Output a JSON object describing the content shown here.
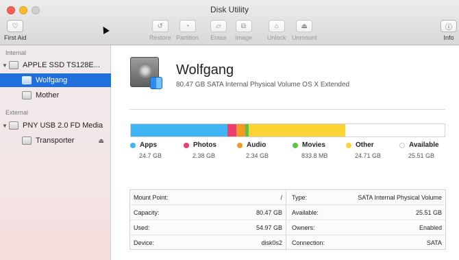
{
  "window": {
    "title": "Disk Utility"
  },
  "toolbar": {
    "first_aid": {
      "label": "First Aid",
      "icon": "stethoscope-icon"
    },
    "restore": {
      "label": "Restore",
      "icon": "restore-icon"
    },
    "partition": {
      "label": "Partition",
      "icon": "partition-icon"
    },
    "erase": {
      "label": "Erase",
      "icon": "erase-icon"
    },
    "image": {
      "label": "Image",
      "icon": "image-icon"
    },
    "unlock": {
      "label": "Unlock",
      "icon": "lock-icon"
    },
    "unmount": {
      "label": "Unmount",
      "icon": "unmount-icon"
    },
    "info": {
      "label": "Info",
      "icon": "info-icon"
    }
  },
  "sidebar": {
    "internal_header": "Internal",
    "external_header": "External",
    "internal_disk": "APPLE SSD TS128E...",
    "volumes_internal": [
      "Wolfgang",
      "Mother"
    ],
    "external_disk": "PNY USB 2.0 FD Media",
    "volumes_external": [
      "Transporter"
    ],
    "selected": "Wolfgang"
  },
  "volume": {
    "name": "Wolfgang",
    "description": "80.47 GB SATA Internal Physical Volume OS X Extended"
  },
  "usage": {
    "segments": [
      {
        "name": "Apps",
        "size": "24.7 GB",
        "gb": 24.7,
        "color": "#3fb5f3"
      },
      {
        "name": "Photos",
        "size": "2.38 GB",
        "gb": 2.38,
        "color": "#ec3f6f"
      },
      {
        "name": "Audio",
        "size": "2.34 GB",
        "gb": 2.34,
        "color": "#f09a28"
      },
      {
        "name": "Movies",
        "size": "833.8 MB",
        "gb": 0.8338,
        "color": "#5ac53e"
      },
      {
        "name": "Other",
        "size": "24.71 GB",
        "gb": 24.71,
        "color": "#fbd334"
      },
      {
        "name": "Available",
        "size": "25.51 GB",
        "gb": 25.51,
        "color": "#ffffff"
      }
    ]
  },
  "info": {
    "mount_point_label": "Mount Point:",
    "mount_point_value": "/",
    "capacity_label": "Capacity:",
    "capacity_value": "80.47 GB",
    "used_label": "Used:",
    "used_value": "54.97 GB",
    "device_label": "Device:",
    "device_value": "disk0s2",
    "type_label": "Type:",
    "type_value": "SATA Internal Physical Volume",
    "available_label": "Available:",
    "available_value": "25.51 GB",
    "owners_label": "Owners:",
    "owners_value": "Enabled",
    "connection_label": "Connection:",
    "connection_value": "SATA"
  }
}
